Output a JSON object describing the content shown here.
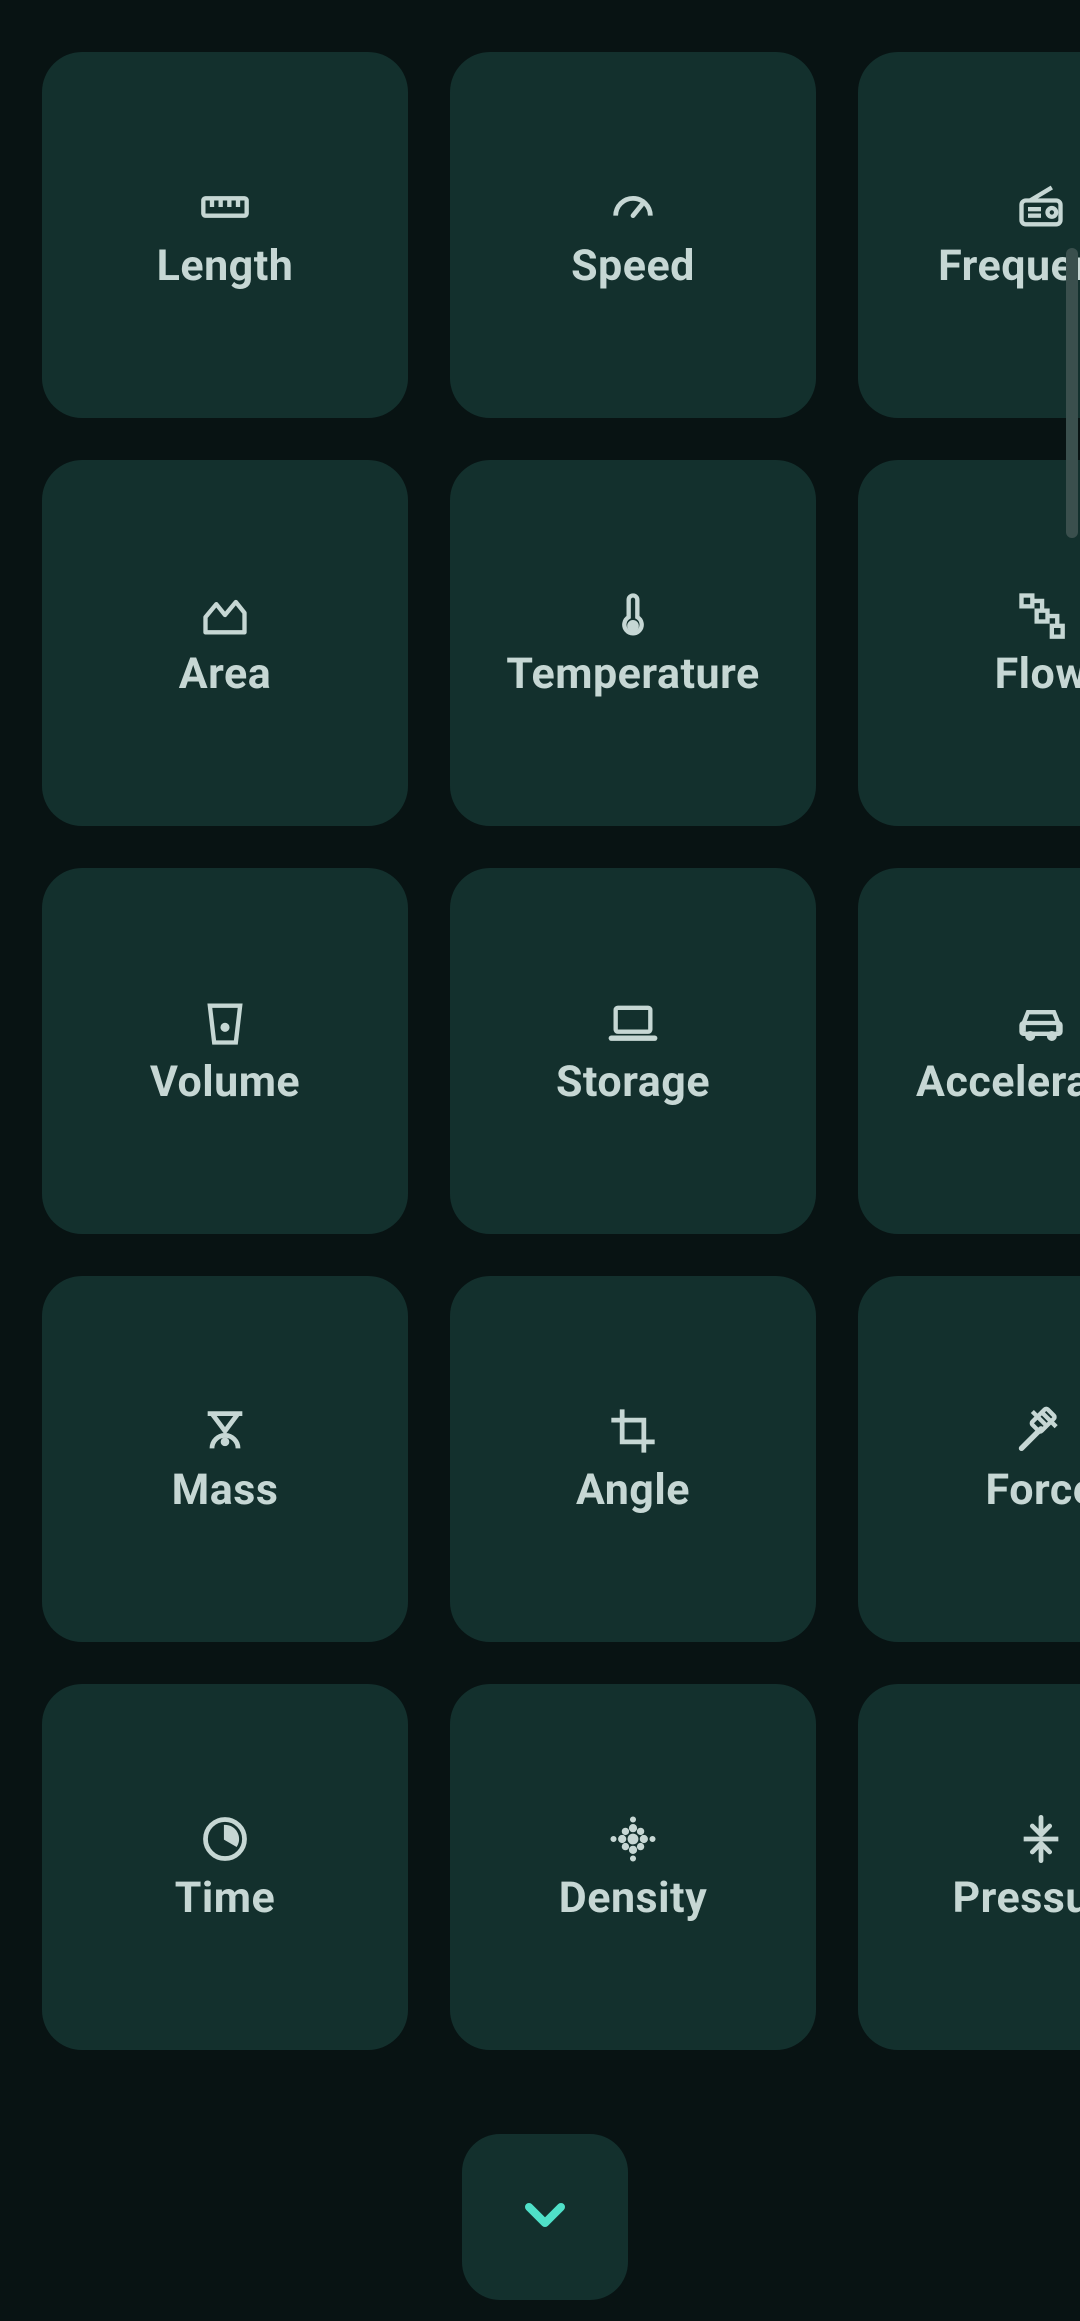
{
  "categories": [
    {
      "id": "length",
      "label": "Length",
      "icon": "ruler"
    },
    {
      "id": "speed",
      "label": "Speed",
      "icon": "gauge"
    },
    {
      "id": "frequency",
      "label": "Frequency",
      "icon": "radio"
    },
    {
      "id": "area",
      "label": "Area",
      "icon": "area"
    },
    {
      "id": "temperature",
      "label": "Temperature",
      "icon": "thermometer"
    },
    {
      "id": "flow",
      "label": "Flow",
      "icon": "flow"
    },
    {
      "id": "volume",
      "label": "Volume",
      "icon": "cup"
    },
    {
      "id": "storage",
      "label": "Storage",
      "icon": "laptop"
    },
    {
      "id": "acceleration",
      "label": "Acceleration",
      "icon": "car"
    },
    {
      "id": "mass",
      "label": "Mass",
      "icon": "scale"
    },
    {
      "id": "angle",
      "label": "Angle",
      "icon": "crop"
    },
    {
      "id": "force",
      "label": "Force",
      "icon": "gavel"
    },
    {
      "id": "time",
      "label": "Time",
      "icon": "clock"
    },
    {
      "id": "density",
      "label": "Density",
      "icon": "blur"
    },
    {
      "id": "pressure",
      "label": "Pressure",
      "icon": "compress"
    }
  ],
  "colors": {
    "background": "#081313",
    "card": "#13302d",
    "text": "#c6d7d4",
    "accent": "#4fe0c8"
  }
}
